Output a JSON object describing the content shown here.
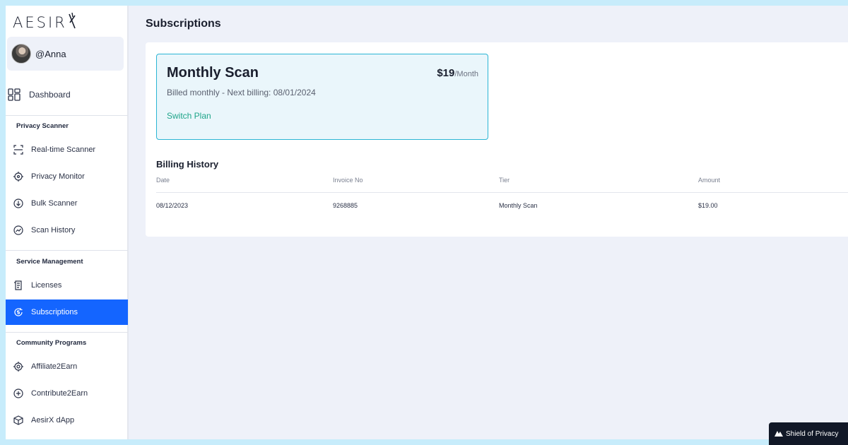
{
  "app": {
    "logo_text": "AESIR"
  },
  "user": {
    "handle": "@Anna"
  },
  "sidebar": {
    "dashboard": {
      "label": "Dashboard",
      "icon": "dashboard-grid-icon"
    },
    "sections": [
      {
        "title": "Privacy Scanner",
        "items": [
          {
            "label": "Real-time Scanner",
            "icon": "scan-icon"
          },
          {
            "label": "Privacy Monitor",
            "icon": "target-icon"
          },
          {
            "label": "Bulk Scanner",
            "icon": "download-circle-icon"
          },
          {
            "label": "Scan History",
            "icon": "history-icon"
          }
        ]
      },
      {
        "title": "Service Management",
        "items": [
          {
            "label": "Licenses",
            "icon": "document-icon"
          },
          {
            "label": "Subscriptions",
            "icon": "subscription-icon",
            "active": true
          }
        ]
      },
      {
        "title": "Community Programs",
        "items": [
          {
            "label": "Affiliate2Earn",
            "icon": "affiliate-icon"
          },
          {
            "label": "Contribute2Earn",
            "icon": "plus-circle-icon"
          },
          {
            "label": "AesirX dApp",
            "icon": "cube-icon"
          }
        ]
      }
    ]
  },
  "main": {
    "title": "Subscriptions",
    "plan": {
      "name": "Monthly Scan",
      "price": "$19",
      "per": "/Month",
      "billing_text": "Billed monthly - Next billing: 08/01/2024",
      "switch_label": "Switch Plan"
    },
    "billing_history": {
      "title": "Billing History",
      "columns": [
        "Date",
        "Invoice No",
        "Tier",
        "Amount"
      ],
      "rows": [
        [
          "08/12/2023",
          "9268885",
          "Monthly Scan",
          "$19.00"
        ]
      ]
    }
  },
  "badge": {
    "label": "Shield of Privacy"
  },
  "colors": {
    "accent": "#1465ff",
    "switch_link": "#1fa58a",
    "plan_border": "#2bb5d4"
  }
}
